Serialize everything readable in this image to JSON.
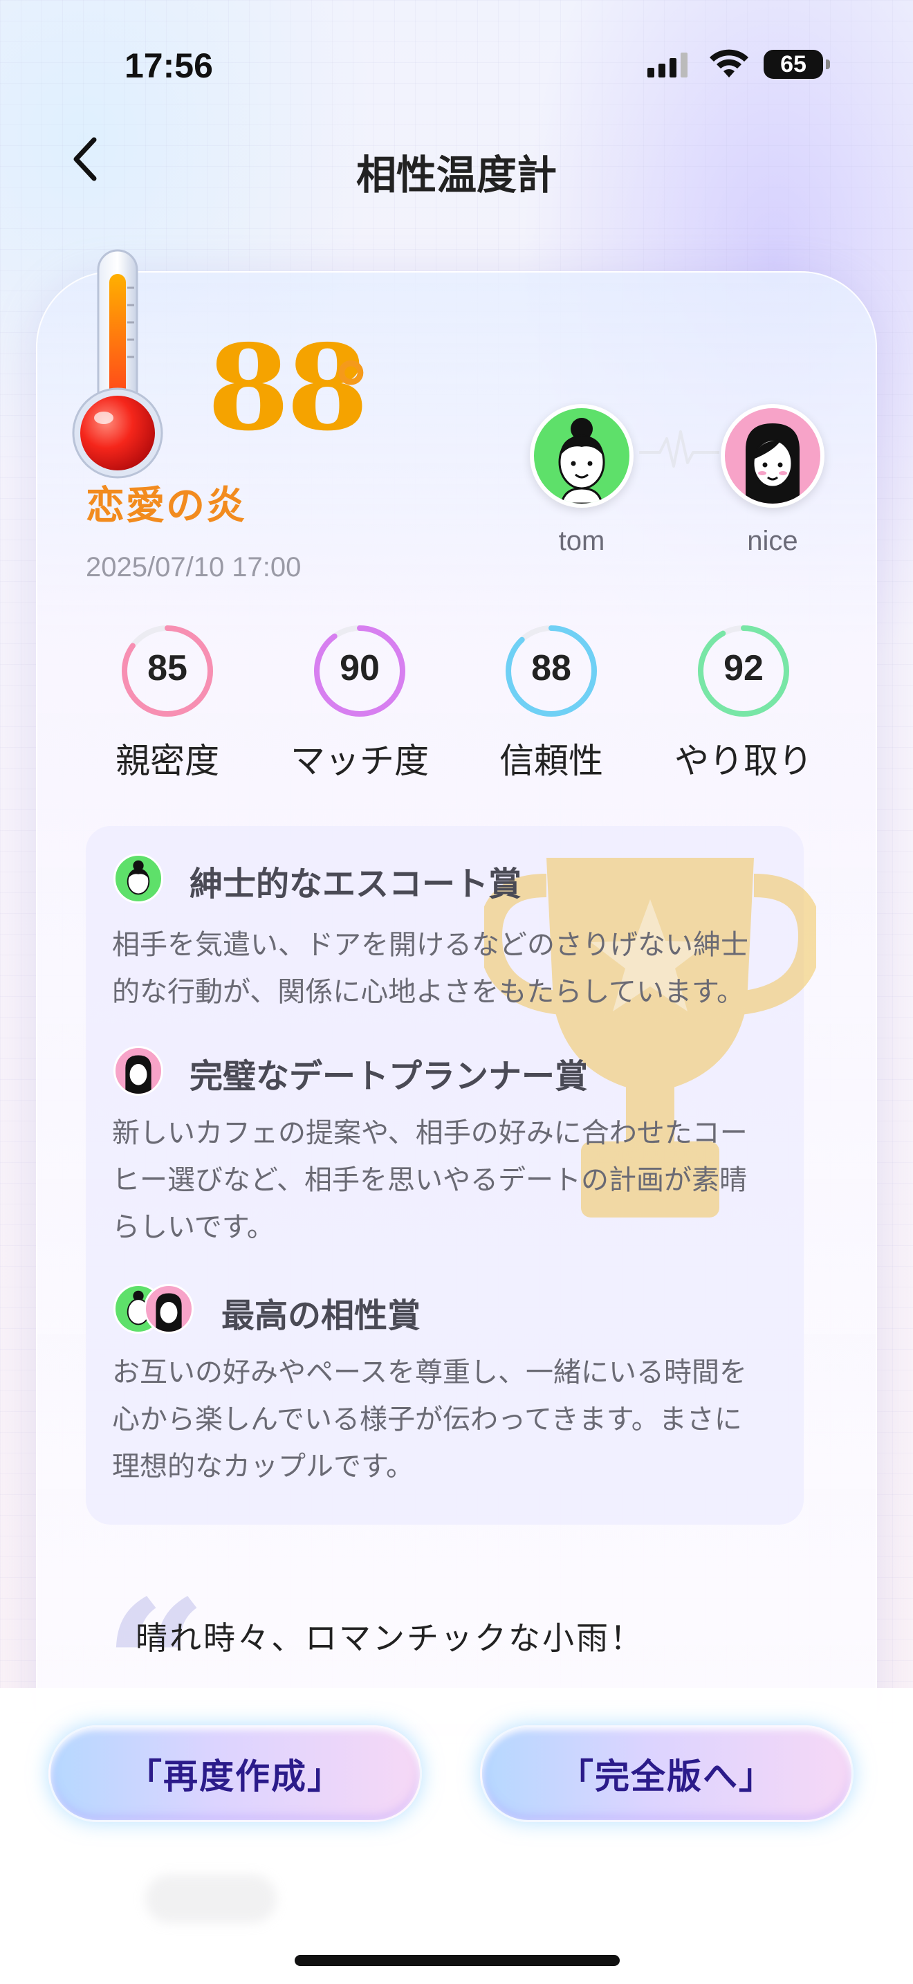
{
  "status_bar": {
    "time": "17:56",
    "battery": "65"
  },
  "nav": {
    "title": "相性温度計"
  },
  "result": {
    "score": "88",
    "degree": "°",
    "label": "恋愛の炎",
    "date": "2025/07/10 17:00",
    "colors": {
      "score": "#f5a300",
      "label": "#f28b1e"
    }
  },
  "people": [
    {
      "name": "tom",
      "avatar_color": "#5ee06a"
    },
    {
      "name": "nice",
      "avatar_color": "#f7a3c8"
    }
  ],
  "stats": [
    {
      "value": 85,
      "label": "親密度",
      "color": "#f78fb2"
    },
    {
      "value": 90,
      "label": "マッチ度",
      "color": "#d77ff0"
    },
    {
      "value": 88,
      "label": "信頼性",
      "color": "#6fd0f5"
    },
    {
      "value": 92,
      "label": "やり取り",
      "color": "#78e6a6"
    }
  ],
  "awards": [
    {
      "title": "紳士的なエスコート賞",
      "text_lines": [
        "相手を気遣い、ドアを開けるなどのさりげない紳士",
        "的な行動が、関係に心地よさをもたらしています。"
      ]
    },
    {
      "title": "完璧なデートプランナー賞",
      "text_lines": [
        "新しいカフェの提案や、相手の好みに合わせたコー",
        "ヒー選びなど、相手を思いやるデートの計画が素晴",
        "らしいです。"
      ]
    },
    {
      "title": "最高の相性賞",
      "text_lines": [
        "お互いの好みやペースを尊重し、一緒にいる時間を",
        "心から楽しんでいる様子が伝わってきます。まさに",
        "理想的なカップルです。"
      ]
    }
  ],
  "quote": "晴れ時々、ロマンチックな小雨！",
  "buttons": {
    "recreate": "「再度作成」",
    "full": "「完全版へ」"
  }
}
